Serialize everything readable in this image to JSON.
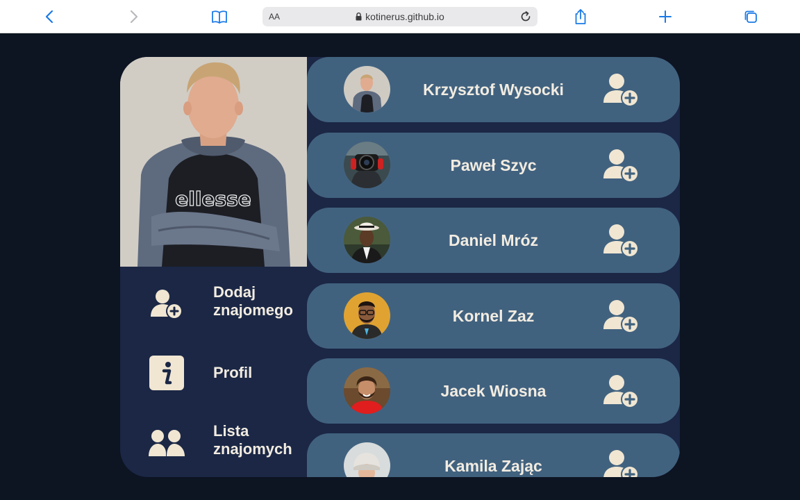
{
  "browser": {
    "text_size_label": "AA",
    "url": "kotinerus.github.io"
  },
  "sidebar": {
    "items": [
      {
        "label": "Dodaj znajomego",
        "icon": "add-user-icon"
      },
      {
        "label": "Profil",
        "icon": "info-icon"
      },
      {
        "label": "Lista znajomych",
        "icon": "users-icon"
      }
    ]
  },
  "friends": [
    {
      "name": "Krzysztof Wysocki"
    },
    {
      "name": "Paweł Szyc"
    },
    {
      "name": "Daniel Mróz"
    },
    {
      "name": "Kornel Zaz"
    },
    {
      "name": "Jacek Wiosna"
    },
    {
      "name": "Kamila Zając"
    }
  ],
  "colors": {
    "page_bg": "#0d1422",
    "card_bg": "#1b2745",
    "friend_card_bg": "#41627f",
    "text": "#f2ece1",
    "accent_blue": "#1a7ae6"
  }
}
